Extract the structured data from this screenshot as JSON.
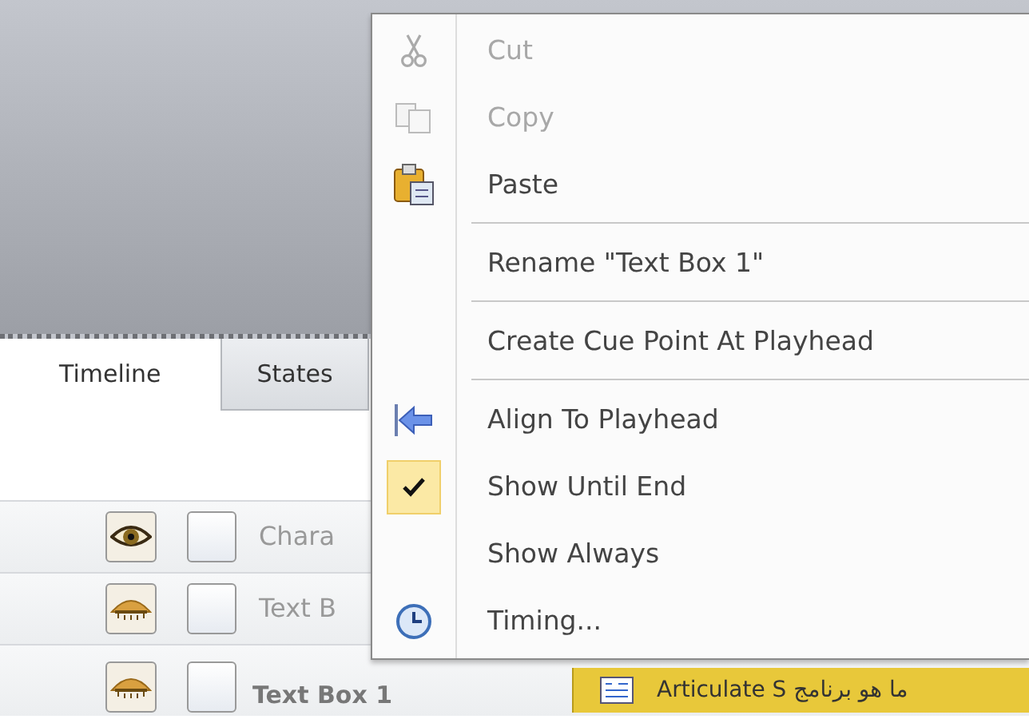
{
  "tabs": [
    {
      "label": "Timeline",
      "selected": true
    },
    {
      "label": "States",
      "selected": false
    }
  ],
  "rows": [
    {
      "label": "Chara",
      "visible": true,
      "locked": false,
      "selected": false
    },
    {
      "label": "Text B",
      "visible": false,
      "locked": false,
      "selected": false
    },
    {
      "label": "Text Box 1",
      "visible": false,
      "locked": false,
      "selected": true,
      "bar_text": "ما هو برنامج Articulate S"
    }
  ],
  "context_menu": {
    "items": [
      {
        "kind": "command",
        "label": "Cut",
        "disabled": true,
        "checked": false
      },
      {
        "kind": "command",
        "label": "Copy",
        "disabled": true,
        "checked": false
      },
      {
        "kind": "command",
        "label": "Paste",
        "disabled": false,
        "checked": false
      },
      {
        "kind": "separator"
      },
      {
        "kind": "command",
        "label": "Rename \"Text Box 1\"",
        "disabled": false,
        "checked": false
      },
      {
        "kind": "separator"
      },
      {
        "kind": "command",
        "label": "Create Cue Point At Playhead",
        "disabled": false,
        "checked": false
      },
      {
        "kind": "separator"
      },
      {
        "kind": "command",
        "label": "Align To Playhead",
        "disabled": false,
        "checked": false
      },
      {
        "kind": "command",
        "label": "Show Until End",
        "disabled": false,
        "checked": true
      },
      {
        "kind": "command",
        "label": "Show Always",
        "disabled": false,
        "checked": false
      },
      {
        "kind": "command",
        "label": "Timing...",
        "disabled": false,
        "checked": false
      }
    ]
  }
}
